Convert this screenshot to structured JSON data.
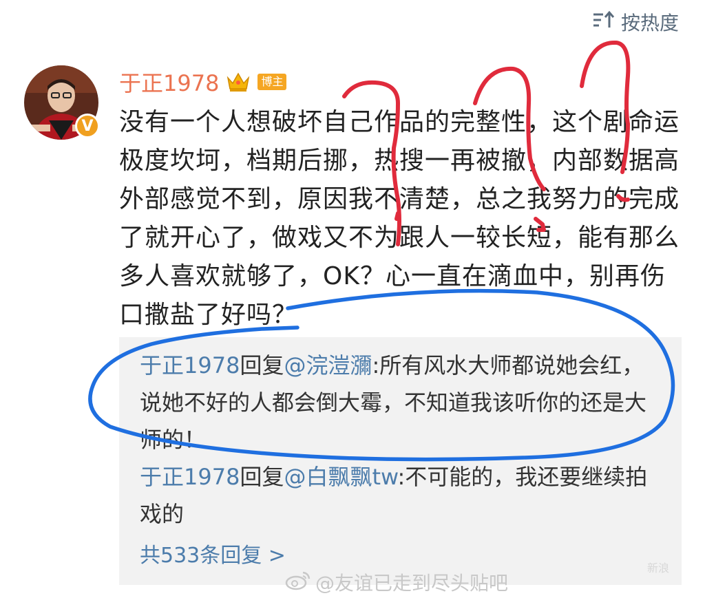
{
  "sort": {
    "label": "按热度",
    "icon": "sort-icon"
  },
  "comment": {
    "username": "于正1978",
    "badge": "博主",
    "verified_icon": "verified-v-icon",
    "crown_icon": "crown-icon",
    "text": "没有一个人想破坏自己作品的完整性，这个剧命运极度坎坷，档期后挪，热搜一再被撤，内部数据高外部感觉不到，原因我不清楚，总之我努力的完成了就开心了，做戏又不为跟人一较长短，能有那么多人喜欢就够了，OK？心一直在滴血中，别再伤口撒盐了好吗？"
  },
  "replies": [
    {
      "author": "于正1978",
      "verb": "回复",
      "mention": "@浣溰瀰",
      "text": ":所有风水大师都说她会红，说她不好的人都会倒大霉，不知道我该听你的还是大师的！"
    },
    {
      "author": "于正1978",
      "verb": "回复",
      "mention": "@白飘飘tw",
      "text": ":不可能的，我还要继续拍戏的"
    }
  ],
  "more_replies": "共533条回复 >",
  "corner_mark": "新浪",
  "watermark": "@友谊已走到尽头贴吧",
  "colors": {
    "username": "#eb7350",
    "link": "#4c7cab",
    "badge": "#f5a623",
    "annotation_red": "#e02b3c",
    "annotation_blue": "#1f6fe0"
  }
}
